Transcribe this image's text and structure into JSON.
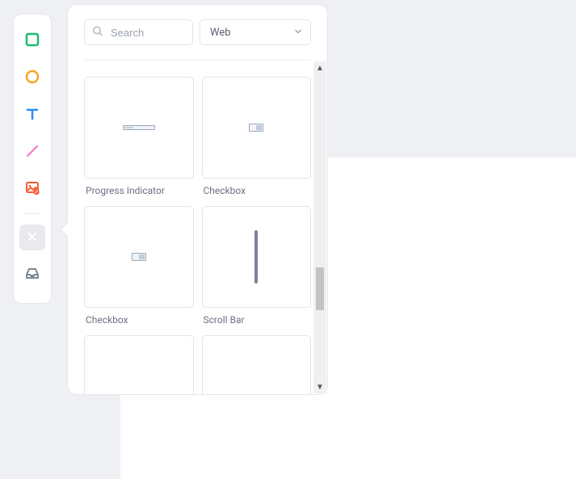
{
  "toolbar": {
    "tools": [
      {
        "name": "rectangle-tool",
        "icon": "rectangle-icon",
        "selected": false
      },
      {
        "name": "ellipse-tool",
        "icon": "ellipse-icon",
        "selected": false
      },
      {
        "name": "text-tool",
        "icon": "text-icon",
        "selected": false
      },
      {
        "name": "line-tool",
        "icon": "line-icon",
        "selected": false
      },
      {
        "name": "image-block-tool",
        "icon": "image-block-icon",
        "selected": false
      }
    ],
    "secondary": [
      {
        "name": "close-tool",
        "icon": "close-icon",
        "selected": true
      },
      {
        "name": "inbox-tool",
        "icon": "inbox-icon",
        "selected": false
      }
    ]
  },
  "panel": {
    "search": {
      "placeholder": "Search",
      "value": ""
    },
    "dropdown": {
      "selected": "Web"
    },
    "items": [
      {
        "label": "Progress Indicator",
        "thumb": "progress"
      },
      {
        "label": "Checkbox",
        "thumb": "checkbox"
      },
      {
        "label": "Checkbox",
        "thumb": "checkbox"
      },
      {
        "label": "Scroll Bar",
        "thumb": "scrollbar"
      },
      {
        "label": "",
        "thumb": "progress"
      },
      {
        "label": "",
        "thumb": "blank"
      }
    ]
  },
  "colors": {
    "green": "#1BBC6D",
    "orange": "#F6A421",
    "blue": "#2C8CF7",
    "pink": "#F76FCB",
    "redOrange": "#F55F33",
    "gray": "#7E8796"
  }
}
